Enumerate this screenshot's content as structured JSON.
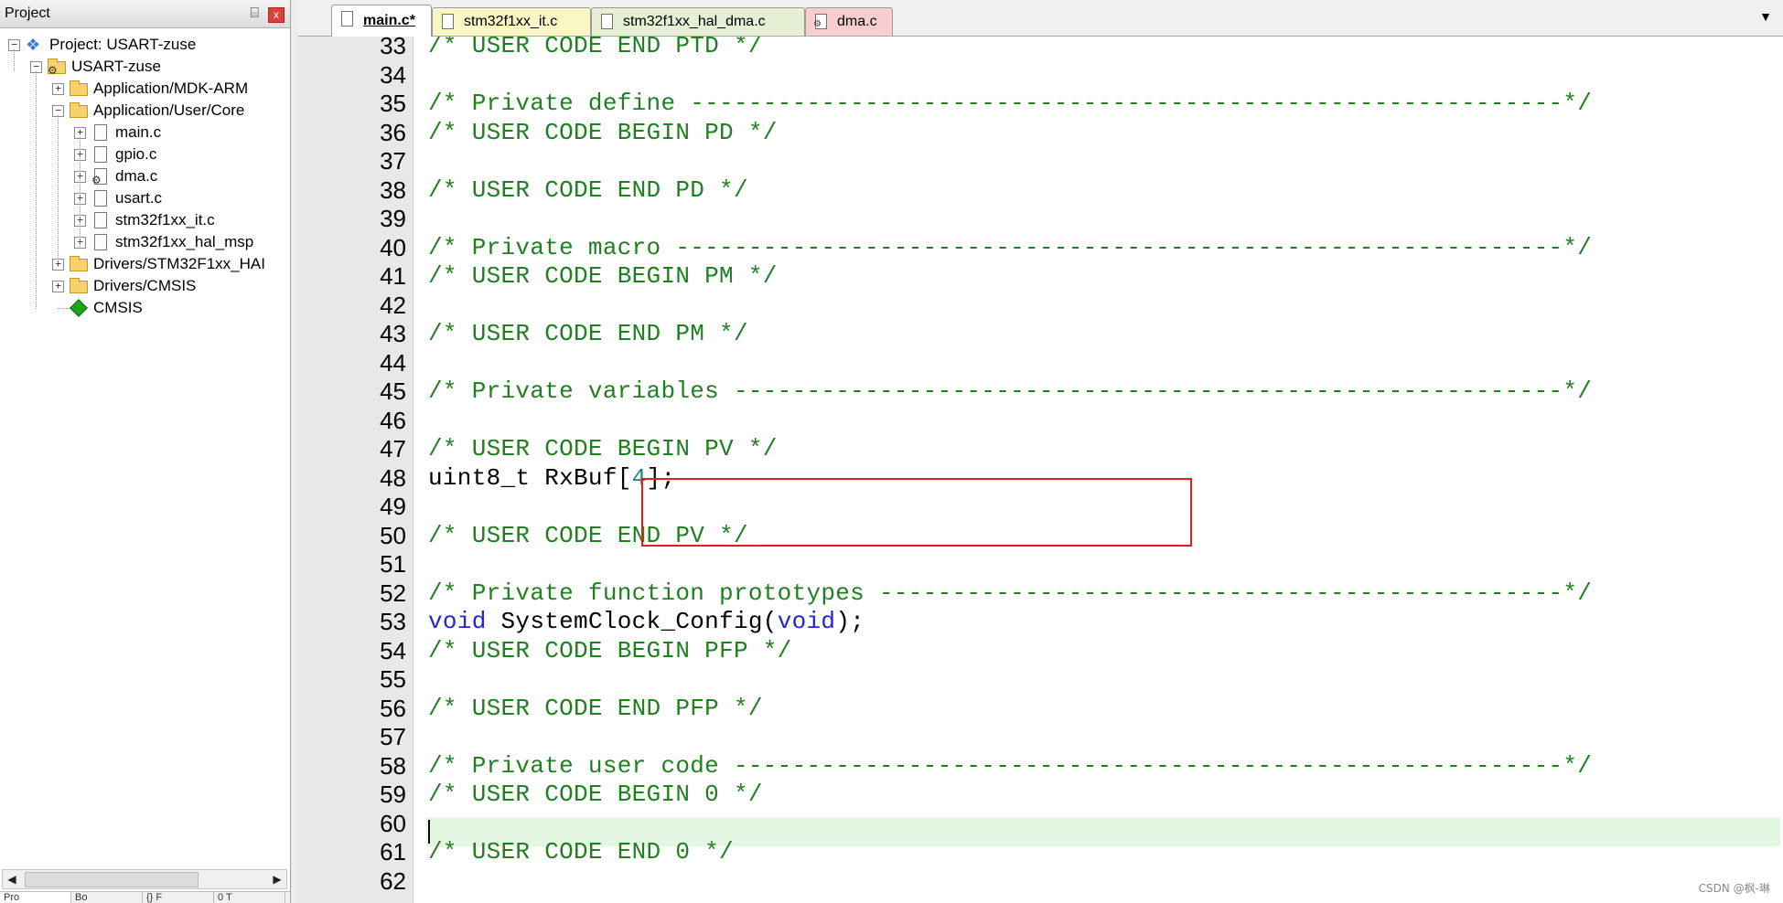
{
  "project_panel": {
    "title": "Project",
    "pin_glyph": "⌸",
    "close_glyph": "x",
    "tree": [
      {
        "label": "Project: USART-zuse",
        "icon": "project-icon",
        "expander": "−"
      },
      {
        "label": "USART-zuse",
        "icon": "target-folder-icon",
        "expander": "−"
      },
      {
        "label": "Application/MDK-ARM",
        "icon": "folder-icon",
        "expander": "+"
      },
      {
        "label": "Application/User/Core",
        "icon": "folder-open-icon",
        "expander": "−"
      },
      {
        "label": "main.c",
        "icon": "file-icon",
        "expander": "+"
      },
      {
        "label": "gpio.c",
        "icon": "file-icon",
        "expander": "+"
      },
      {
        "label": "dma.c",
        "icon": "file-gear-icon",
        "expander": "+"
      },
      {
        "label": "usart.c",
        "icon": "file-icon",
        "expander": "+"
      },
      {
        "label": "stm32f1xx_it.c",
        "icon": "file-icon",
        "expander": "+"
      },
      {
        "label": "stm32f1xx_hal_msp",
        "icon": "file-icon",
        "expander": "+"
      },
      {
        "label": "Drivers/STM32F1xx_HAI",
        "icon": "folder-icon",
        "expander": "+"
      },
      {
        "label": "Drivers/CMSIS",
        "icon": "folder-icon",
        "expander": "+"
      },
      {
        "label": "CMSIS",
        "icon": "cmsis-diamond-icon",
        "expander": ""
      }
    ],
    "bottom_tabs": [
      "Pro",
      "Bo",
      "{} F",
      "0 T"
    ]
  },
  "editor": {
    "tabs": [
      {
        "label": "main.c*",
        "active": true,
        "color": "#ffffff"
      },
      {
        "label": "stm32f1xx_it.c",
        "active": false,
        "color": "#fbf7c4"
      },
      {
        "label": "stm32f1xx_hal_dma.c",
        "active": false,
        "color": "#e6efd4"
      },
      {
        "label": "dma.c",
        "active": false,
        "color": "#f7cdd0"
      }
    ],
    "dropdown_glyph": "▼",
    "lines": [
      {
        "n": "33",
        "parts": [
          {
            "t": "/* USER CODE END PTD */",
            "c": "comment"
          }
        ]
      },
      {
        "n": "34",
        "parts": []
      },
      {
        "n": "35",
        "parts": [
          {
            "t": "/* Private define ------------------------------------------------------------*/",
            "c": "comment"
          }
        ]
      },
      {
        "n": "36",
        "parts": [
          {
            "t": "/* USER CODE BEGIN PD */",
            "c": "comment"
          }
        ]
      },
      {
        "n": "37",
        "parts": []
      },
      {
        "n": "38",
        "parts": [
          {
            "t": "/* USER CODE END PD */",
            "c": "comment"
          }
        ]
      },
      {
        "n": "39",
        "parts": []
      },
      {
        "n": "40",
        "parts": [
          {
            "t": "/* Private macro -------------------------------------------------------------*/",
            "c": "comment"
          }
        ]
      },
      {
        "n": "41",
        "parts": [
          {
            "t": "/* USER CODE BEGIN PM */",
            "c": "comment"
          }
        ]
      },
      {
        "n": "42",
        "parts": []
      },
      {
        "n": "43",
        "parts": [
          {
            "t": "/* USER CODE END PM */",
            "c": "comment"
          }
        ]
      },
      {
        "n": "44",
        "parts": []
      },
      {
        "n": "45",
        "parts": [
          {
            "t": "/* Private variables ---------------------------------------------------------*/",
            "c": "comment"
          }
        ]
      },
      {
        "n": "46",
        "parts": []
      },
      {
        "n": "47",
        "parts": [
          {
            "t": "/* USER CODE BEGIN PV */",
            "c": "comment"
          }
        ]
      },
      {
        "n": "48",
        "parts": [
          {
            "t": "uint8_t RxBuf[",
            "c": "normal"
          },
          {
            "t": "4",
            "c": "number"
          },
          {
            "t": "];",
            "c": "normal"
          }
        ]
      },
      {
        "n": "49",
        "parts": []
      },
      {
        "n": "50",
        "parts": [
          {
            "t": "/* USER CODE END PV */",
            "c": "comment"
          }
        ]
      },
      {
        "n": "51",
        "parts": []
      },
      {
        "n": "52",
        "parts": [
          {
            "t": "/* Private function prototypes -----------------------------------------------*/",
            "c": "comment"
          }
        ]
      },
      {
        "n": "53",
        "parts": [
          {
            "t": "void",
            "c": "keyword"
          },
          {
            "t": " SystemClock_Config(",
            "c": "normal"
          },
          {
            "t": "void",
            "c": "keyword"
          },
          {
            "t": ");",
            "c": "normal"
          }
        ]
      },
      {
        "n": "54",
        "parts": [
          {
            "t": "/* USER CODE BEGIN PFP */",
            "c": "comment"
          }
        ]
      },
      {
        "n": "55",
        "parts": []
      },
      {
        "n": "56",
        "parts": [
          {
            "t": "/* USER CODE END PFP */",
            "c": "comment"
          }
        ]
      },
      {
        "n": "57",
        "parts": []
      },
      {
        "n": "58",
        "parts": [
          {
            "t": "/* Private user code ---------------------------------------------------------*/",
            "c": "comment"
          }
        ]
      },
      {
        "n": "59",
        "parts": [
          {
            "t": "/* USER CODE BEGIN 0 */",
            "c": "comment"
          }
        ]
      },
      {
        "n": "60",
        "parts": []
      },
      {
        "n": "61",
        "parts": [
          {
            "t": "/* USER CODE END 0 */",
            "c": "comment"
          }
        ]
      },
      {
        "n": "62",
        "parts": []
      }
    ],
    "colors": {
      "comment": "#208020",
      "keyword": "#2525d6",
      "number": "#208080",
      "current_line": "#e3f7e3",
      "highlight_box": "#e02020"
    }
  },
  "watermark": "CSDN @枫-琳"
}
